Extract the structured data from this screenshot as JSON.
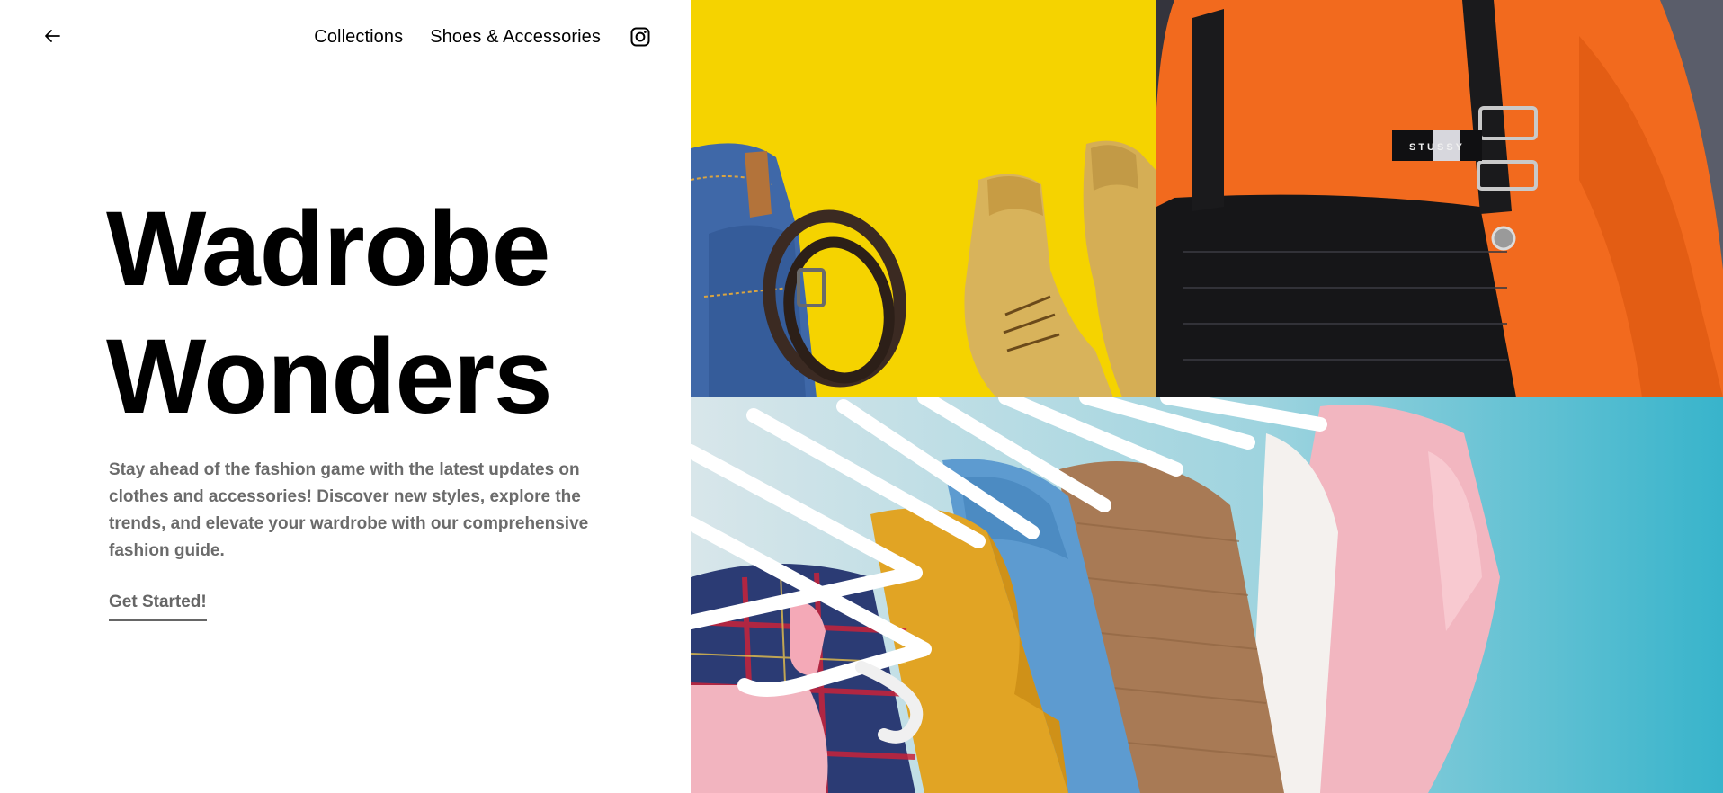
{
  "nav": {
    "back_icon": "arrow-left-icon",
    "links": [
      "Collections",
      "Shoes & Accessories"
    ],
    "social_icon": "instagram-icon"
  },
  "hero": {
    "title_line1": "Wadrobe",
    "title_line2": "Wonders",
    "description": "Stay ahead of the fashion game with the latest updates on clothes and accessories! Discover new styles, explore the trends, and elevate your wardrobe with our comprehensive fashion guide.",
    "cta_label": "Get Started!"
  },
  "images": {
    "tile1": "denim-belt-boots-photo",
    "tile2": "orange-sweater-overalls-photo",
    "tile2_label": "STUSSY",
    "tile3": "clothes-on-hangers-photo"
  },
  "colors": {
    "tile1_bg": "#f5d300",
    "tile2_sweater": "#f26a1e",
    "tile3_bg": "#48bcd0",
    "text_muted": "#6b6b6b"
  }
}
